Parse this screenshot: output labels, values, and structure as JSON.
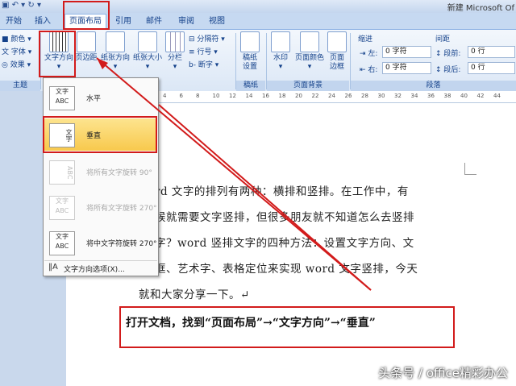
{
  "window": {
    "title": "新建 Microsoft Of"
  },
  "tabs": [
    {
      "label": "开始"
    },
    {
      "label": "插入"
    },
    {
      "label": "页面布局"
    },
    {
      "label": "引用"
    },
    {
      "label": "邮件"
    },
    {
      "label": "审阅"
    },
    {
      "label": "视图"
    }
  ],
  "ribbon": {
    "theme": {
      "colors": "颜色",
      "fonts": "字体",
      "effects": "效果",
      "group": "主题"
    },
    "page_setup": {
      "text_direction": "文字方向",
      "margins": "页边距",
      "orientation": "纸张方向",
      "size": "纸张大小",
      "columns": "分栏",
      "breaks": "分隔符",
      "line_numbers": "行号",
      "hyphenation": "断字"
    },
    "draft": {
      "label": "稿纸设置",
      "group": "稿纸"
    },
    "page_background": {
      "watermark": "水印",
      "page_color": "页面颜色",
      "page_borders": "页面边框",
      "group": "页面背景"
    },
    "paragraph": {
      "indent": "缩进",
      "spacing": "间距",
      "left_label": "左:",
      "left_value": "0 字符",
      "right_label": "右:",
      "right_value": "0 字符",
      "before_label": "段前:",
      "before_value": "0 行",
      "after_label": "段后:",
      "after_value": "0 行",
      "group": "段落"
    }
  },
  "ruler": [
    "4",
    "6",
    "8",
    "10",
    "12",
    "14",
    "16",
    "18",
    "20",
    "22",
    "24",
    "26",
    "28",
    "30",
    "32",
    "34",
    "36",
    "38",
    "40",
    "42",
    "44"
  ],
  "text_direction_menu": {
    "items": [
      {
        "thumb": "文字\nABC",
        "label": "水平",
        "enabled": true
      },
      {
        "thumb": "文字",
        "label": "垂直",
        "enabled": true,
        "selected": true
      },
      {
        "thumb": "ABC",
        "label": "将所有文字旋转 90°",
        "enabled": false
      },
      {
        "thumb": "文字\nABC",
        "label": "将所有文字旋转 270°",
        "enabled": false
      },
      {
        "thumb": "文字\nABC",
        "label": "将中文字符旋转 270°",
        "enabled": true
      }
    ],
    "options": "文字方向选项(X)..."
  },
  "document": {
    "lines": [
      "rd  文字的排列有两种：横排和竖排。在工作中，有",
      "候就需要文字竖排，但很多朋友就不知道怎么去竖排",
      "字？word  竖排文字的四种方法：设置文字方向、文",
      "框、艺术字、表格定位来实现 word 文字竖排，今天",
      "就和大家分享一下。↵"
    ]
  },
  "callout": "打开文档，找到“页面布局”→“文字方向”→“垂直”",
  "watermark": "头条号 / office精彩办公",
  "colors": {
    "highlight": "#d21b1b",
    "selected": "#f8c94d",
    "ribbon": "#dbe7f6"
  }
}
